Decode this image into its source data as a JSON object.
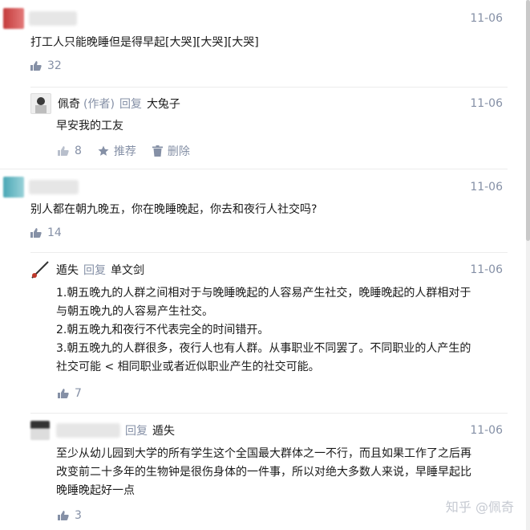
{
  "comments": [
    {
      "user": "",
      "time": "11-06",
      "text": "打工人只能晚睡但是得早起[大哭][大哭][大哭]",
      "likes": "32"
    },
    {
      "user": "佩奇",
      "author_tag": "(作者)",
      "reply_label": "回复",
      "reply_to": "大兔子",
      "time": "11-06",
      "text": "早安我的工友",
      "likes": "8",
      "recommend_label": "推荐",
      "delete_label": "删除"
    },
    {
      "user": "",
      "time": "11-06",
      "text": "别人都在朝九晚五，你在晚睡晚起，你去和夜行人社交吗?",
      "likes": "14"
    },
    {
      "user": "遁失",
      "reply_label": "回复",
      "reply_to": "单文剑",
      "time": "11-06",
      "lines": [
        "1.朝五晚九的人群之间相对于与晚睡晚起的人容易产生社交，晚睡晚起的人群相对于",
        "与朝五晚九的人容易产生社交。",
        "2.朝五晚九和夜行不代表完全的时间错开。",
        "3.朝五晚九的人群很多，夜行人也有人群。从事职业不同罢了。不同职业的人产生的",
        "社交可能 < 相同职业或者近似职业产生的社交可能。"
      ],
      "likes": "7"
    },
    {
      "user": "",
      "reply_label": "回复",
      "reply_to": "遁失",
      "time": "11-06",
      "lines": [
        "至少从幼儿园到大学的所有学生这个全国最大群体之一不行，而且如果工作了之后再",
        "改变前二十多年的生物钟是很伤身体的一件事，所以对绝大多数人来说，早睡早起比",
        "晚睡晚起好一点"
      ],
      "likes": "3"
    }
  ],
  "watermark": "知乎 @佩奇"
}
